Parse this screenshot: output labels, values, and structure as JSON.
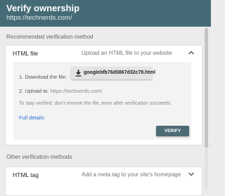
{
  "header": {
    "title": "Verify ownership",
    "url": "https://technerds.com/"
  },
  "recommended": {
    "section_label": "Recommended verification method",
    "method_name": "HTML file",
    "method_description": "Upload an HTML file to your website",
    "step1_label": "1. Download the file:",
    "download_filename": "googlebfb76d0867d32c78.html",
    "step2_prefix": "2. Upload to:",
    "upload_url": "https://technerds.com/",
    "note": "To stay verified, don't remove the file, even after verification succeeds.",
    "details_link": "Full details",
    "verify_button": "VERIFY"
  },
  "other": {
    "section_label": "Other verification methods",
    "method_name": "HTML tag",
    "method_description": "Add a meta tag to your site's homepage"
  },
  "colors": {
    "header_bg": "#456b76",
    "verify_bg": "#4d6b75",
    "link": "#2a6fd6"
  },
  "icons": {
    "download": "download-icon",
    "expand": "chevron-up-icon",
    "collapse": "chevron-down-icon"
  }
}
